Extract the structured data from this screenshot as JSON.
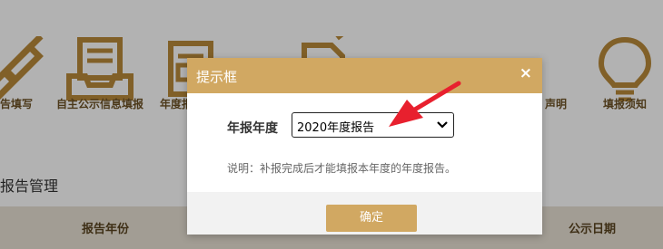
{
  "nav": {
    "items": [
      {
        "label": "告填写",
        "icon": "pencil-icon"
      },
      {
        "label": "自主公示信息填报",
        "icon": "document-tray-icon"
      },
      {
        "label": "年度报",
        "icon": "report-icon"
      },
      {
        "label": "声明",
        "icon": "document-icon"
      },
      {
        "label": "填报须知",
        "icon": "lightbulb-icon"
      }
    ]
  },
  "section": {
    "title": "报告管理"
  },
  "table": {
    "headers": [
      "报告年份",
      "公示日期"
    ]
  },
  "dialog": {
    "title": "提示框",
    "close_glyph": "×",
    "field_label": "年报年度",
    "select_value": "2020年度报告",
    "note": "说明：补报完成后才能填报本年度的年度报告。",
    "confirm_label": "确定"
  },
  "colors": {
    "accent": "#d1a862",
    "arrow": "#e8202e"
  }
}
